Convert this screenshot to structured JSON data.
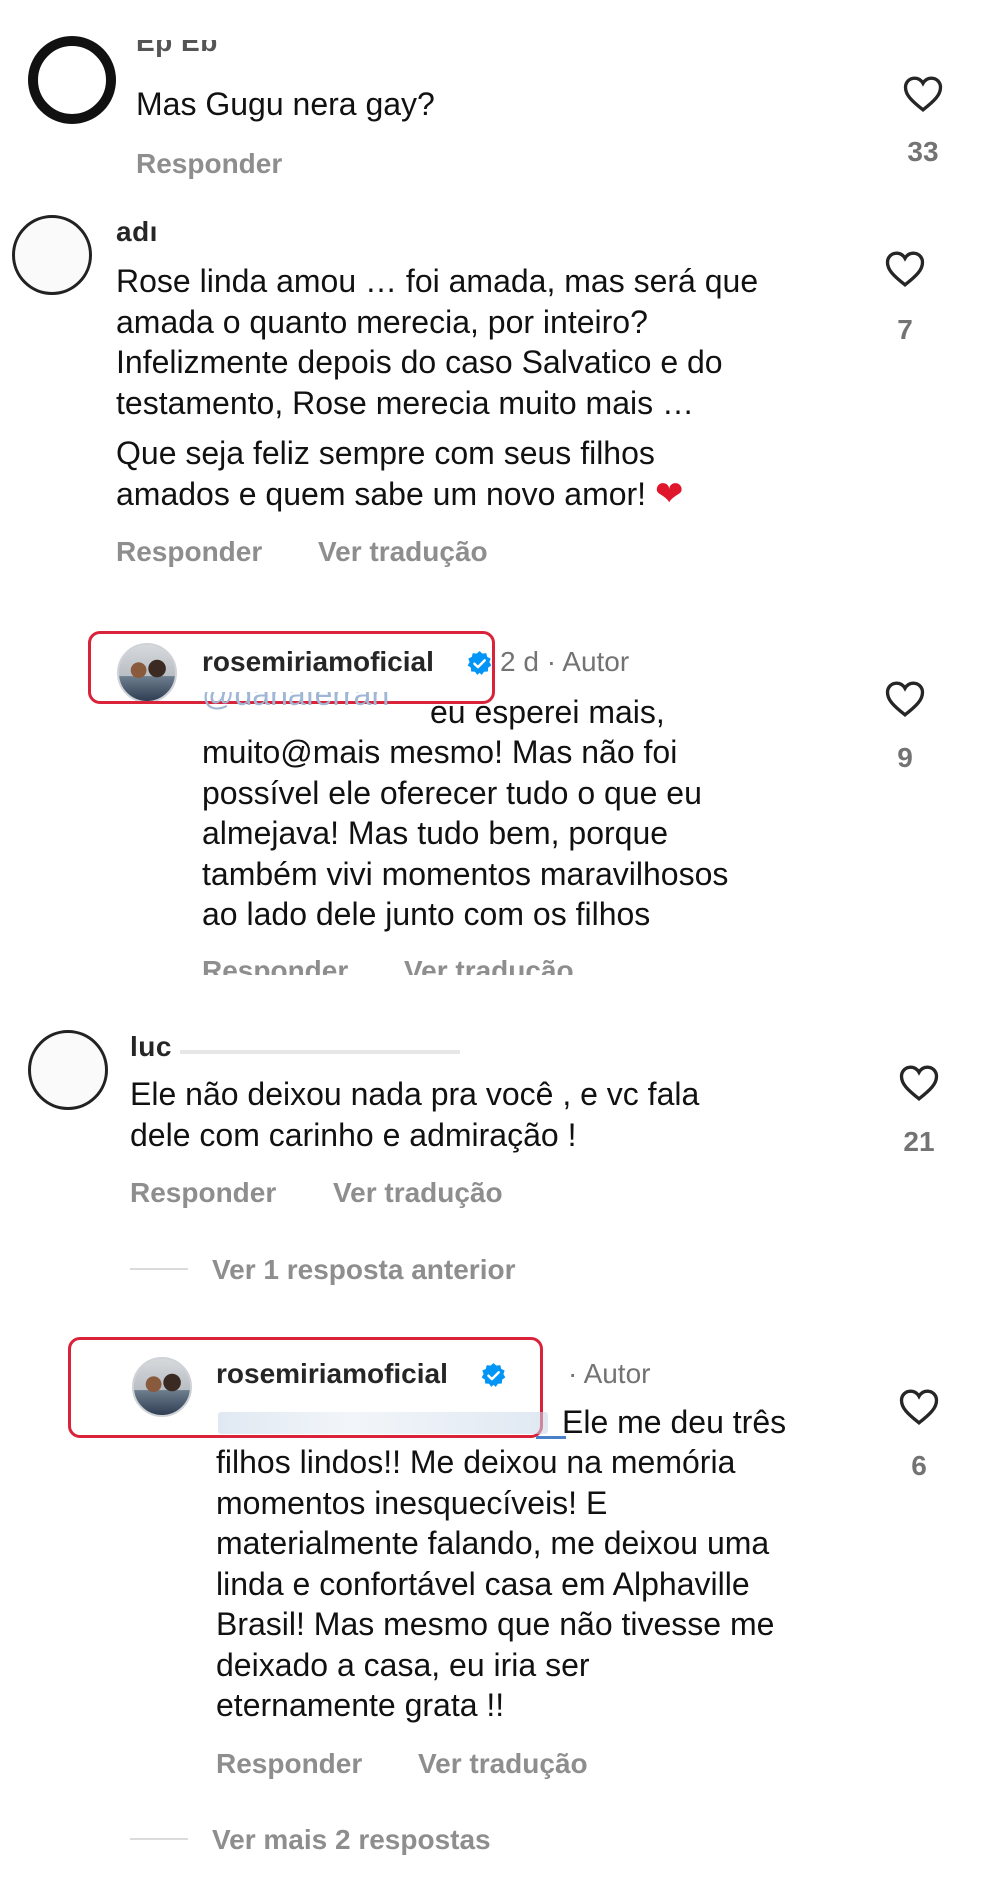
{
  "comments": [
    {
      "username_fragment": "Ep Eb",
      "text": "Mas Gugu nera gay?",
      "actions": [
        "Responder"
      ],
      "likes": "33"
    },
    {
      "username_fragment": "adı",
      "text_lines": [
        "Rose linda amou … foi amada, mas será que",
        "amada o quanto merecia, por inteiro?",
        "Infelizmente depois do caso Salvatico e do",
        "testamento, Rose merecia muito mais …"
      ],
      "text2": "Que seja feliz sempre com seus filhos",
      "text3": "amados e quem sabe um novo amor!",
      "emoji": "❤️",
      "actions": [
        "Responder",
        "Ver tradução"
      ],
      "likes": "7"
    },
    {
      "username": "rosemiriamoficial",
      "time": "2 d",
      "separator": "·",
      "author_badge": "Autor",
      "mention_fragment": "@danaferran",
      "first_line_rest": "eu esperei mais,",
      "text_lines": [
        "muito@mais mesmo! Mas não foi",
        "possível ele oferecer tudo o que eu",
        "almejava! Mas tudo bem, porque",
        "também vivi momentos maravilhosos",
        "ao lado dele junto com os filhos"
      ],
      "actions": [
        "Responder",
        "Ver tradução"
      ],
      "likes": "9"
    },
    {
      "username_fragment": "luc",
      "text_lines": [
        "Ele não deixou nada pra você , e vc fala",
        "dele com carinho e admiração !"
      ],
      "actions": [
        "Responder",
        "Ver tradução"
      ],
      "likes": "21"
    },
    {
      "view_previous": "Ver 1 resposta anterior"
    },
    {
      "username": "rosemiriamoficial",
      "separator": "·",
      "author_badge": "Autor",
      "first_line_rest": "Ele me deu três",
      "text_lines": [
        "filhos lindos!! Me deixou na memória",
        "momentos inesquecíveis! E",
        "materialmente falando, me deixou uma",
        "linda e confortável casa em Alphaville",
        "Brasil! Mas mesmo que não tivesse me",
        "deixado a casa, eu iria ser",
        "eternamente grata !!"
      ],
      "actions": [
        "Responder",
        "Ver tradução"
      ],
      "likes": "6"
    },
    {
      "view_more": "Ver mais 2 respostas"
    }
  ],
  "colors": {
    "highlight": "#d9233a",
    "verified": "#0095f6",
    "action_gray": "#8e8e8e"
  },
  "icons": [
    "heart-outline-icon",
    "verified-badge-icon"
  ]
}
